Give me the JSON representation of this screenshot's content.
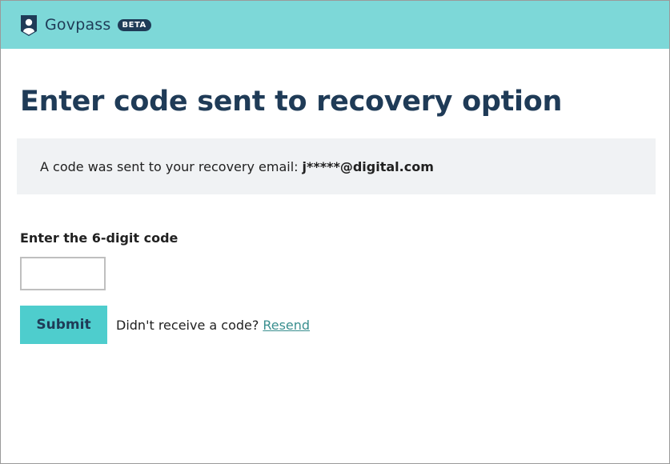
{
  "header": {
    "brand": "Govpass",
    "badge": "BETA",
    "logo_icon": "shield-person-icon"
  },
  "page": {
    "title": "Enter code sent to recovery option"
  },
  "notice": {
    "text": "A code was sent to your recovery email:",
    "email": "j*****@digital.com"
  },
  "form": {
    "code_label": "Enter the 6-digit code",
    "code_value": "",
    "submit_label": "Submit",
    "resend_prompt": "Didn't receive a code?",
    "resend_link": "Resend"
  },
  "colors": {
    "header_bg": "#7dd8d8",
    "brand_navy": "#1f3b57",
    "button_bg": "#4ecdcd",
    "link": "#3a8f8f",
    "notice_bg": "#f0f2f4"
  }
}
